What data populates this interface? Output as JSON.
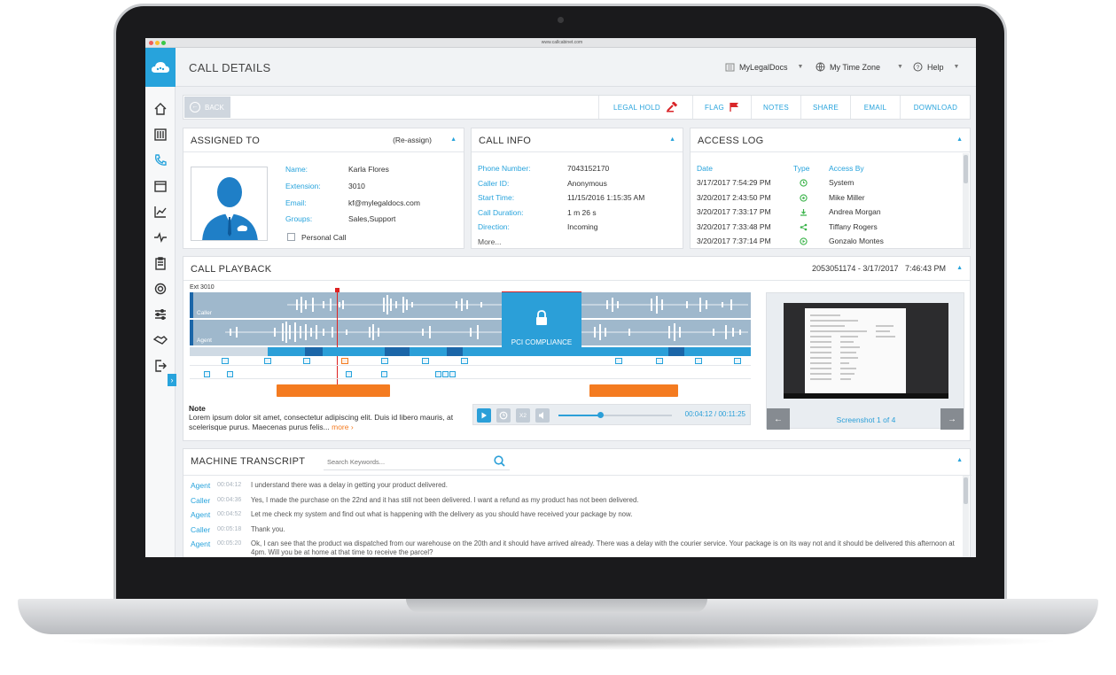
{
  "browser": {
    "url": "www.callcabinet.com"
  },
  "header": {
    "title": "CALL DETAILS",
    "account": "MyLegalDocs",
    "timezone": "My Time Zone",
    "help": "Help"
  },
  "toolbar": {
    "back": "BACK",
    "legal_hold": "LEGAL HOLD",
    "flag": "FLAG",
    "notes": "NOTES",
    "share": "SHARE",
    "email": "EMAIL",
    "download": "DOWNLOAD"
  },
  "assigned": {
    "title": "ASSIGNED TO",
    "reassign": "(Re-assign)",
    "fields": [
      {
        "label": "Name:",
        "value": "Karla Flores"
      },
      {
        "label": "Extension:",
        "value": "3010"
      },
      {
        "label": "Email:",
        "value": "kf@mylegaldocs.com"
      },
      {
        "label": "Groups:",
        "value": "Sales,Support"
      }
    ],
    "personal_call": "Personal Call"
  },
  "callinfo": {
    "title": "CALL INFO",
    "fields": [
      {
        "label": "Phone Number:",
        "value": "7043152170"
      },
      {
        "label": "Caller ID:",
        "value": "Anonymous"
      },
      {
        "label": "Start Time:",
        "value": "11/15/2016 1:15:35 AM"
      },
      {
        "label": "Call Duration:",
        "value": "1 m 26 s"
      },
      {
        "label": "Direction:",
        "value": "Incoming"
      }
    ],
    "more": "More..."
  },
  "access": {
    "title": "ACCESS LOG",
    "headers": {
      "date": "Date",
      "type": "Type",
      "by": "Access By"
    },
    "rows": [
      {
        "date": "3/17/2017 7:54:29 PM",
        "by": "System"
      },
      {
        "date": "3/20/2017 2:43:50 PM",
        "by": "Mike Miller"
      },
      {
        "date": "3/20/2017 7:33:17 PM",
        "by": "Andrea Morgan"
      },
      {
        "date": "3/20/2017 7:33:48 PM",
        "by": "Tiffany Rogers"
      },
      {
        "date": "3/20/2017 7:37:14 PM",
        "by": "Gonzalo Montes"
      }
    ]
  },
  "playback": {
    "title": "CALL PLAYBACK",
    "meta": "2053051174 - 3/17/2017   7:46:43 PM",
    "ext": "Ext 3010",
    "caller": "Caller",
    "agent": "Agent",
    "pci": "PCI COMPLIANCE",
    "note_title": "Note",
    "note_text": "Lorem ipsum dolor sit amet, consectetur adipiscing elit. Duis id libero mauris, at scelerisque purus. Maecenas purus felis...",
    "more": "more ›",
    "speed": "X2",
    "time": "00:04:12 / 00:11:25",
    "progress": 0.37,
    "screenshot": "Screenshot",
    "shot_count": "1 of 4"
  },
  "transcript": {
    "title": "MACHINE TRANSCRIPT",
    "search_placeholder": "Search Keywords...",
    "rows": [
      {
        "speaker": "Agent",
        "time": "00:04:12",
        "text": "I understand there was a delay in getting your product delivered."
      },
      {
        "speaker": "Caller",
        "time": "00:04:36",
        "text": "Yes, I made the purchase on the 22nd and it has still not been delivered. I want a refund as my product has not been delivered."
      },
      {
        "speaker": "Agent",
        "time": "00:04:52",
        "text": "Let me check my system and find out what is happening with the delivery as you should have received your package by now."
      },
      {
        "speaker": "Caller",
        "time": "00:05:18",
        "text": "Thank you."
      },
      {
        "speaker": "Agent",
        "time": "00:05:20",
        "text": "Ok, I can see that the product wa dispatched from our warehouse on the 20th and it should have arrived already. There was a delay with the courier service. Your package is on its way not and it should be delivered this afternoon at 4pm. Will you be at home at that time to receive the parcel?"
      }
    ]
  },
  "colors": {
    "accent": "#27a3dc",
    "orange": "#f47b20",
    "flag": "#d9262a"
  }
}
